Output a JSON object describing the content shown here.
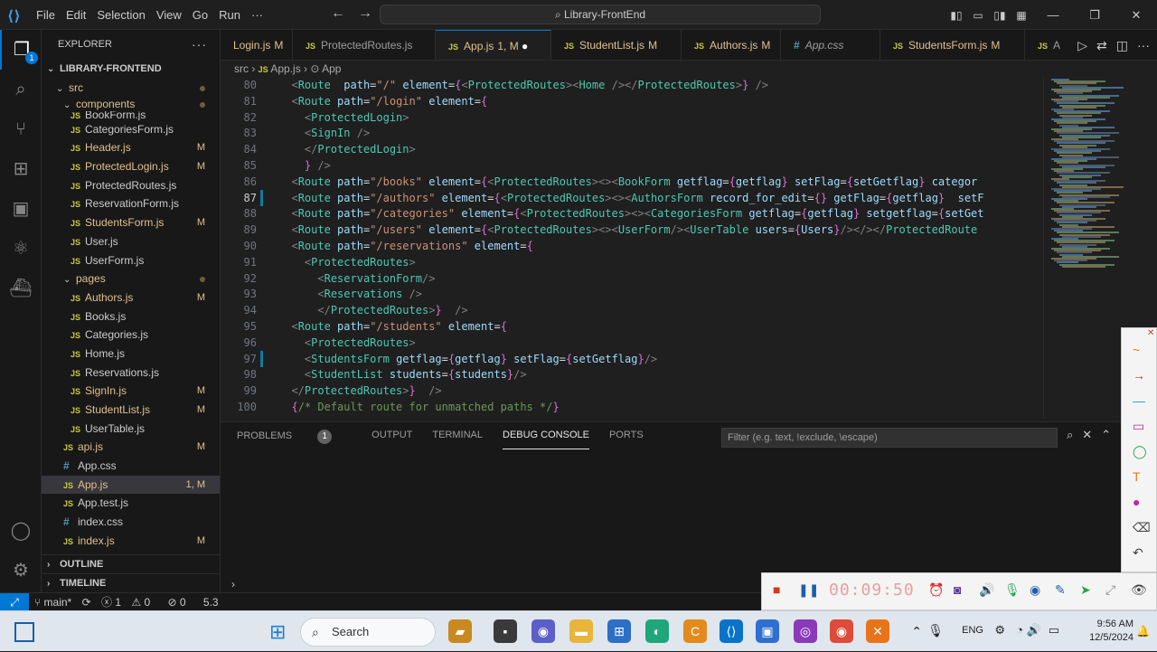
{
  "menu": [
    "File",
    "Edit",
    "Selection",
    "View",
    "Go",
    "Run",
    "···"
  ],
  "search": "Library-FrontEnd",
  "explorer": {
    "title": "EXPLORER",
    "project": "LIBRARY-FRONTEND",
    "src": "src",
    "components": "components",
    "pages": "pages",
    "files_components": [
      {
        "name": "BookForm.js",
        "status": ""
      },
      {
        "name": "CategoriesForm.js",
        "status": ""
      },
      {
        "name": "Header.js",
        "status": "M"
      },
      {
        "name": "ProtectedLogin.js",
        "status": "M"
      },
      {
        "name": "ProtectedRoutes.js",
        "status": ""
      },
      {
        "name": "ReservationForm.js",
        "status": ""
      },
      {
        "name": "StudentsForm.js",
        "status": "M"
      },
      {
        "name": "User.js",
        "status": ""
      },
      {
        "name": "UserForm.js",
        "status": ""
      }
    ],
    "files_pages": [
      {
        "name": "Authors.js",
        "status": "M"
      },
      {
        "name": "Books.js",
        "status": ""
      },
      {
        "name": "Categories.js",
        "status": ""
      },
      {
        "name": "Home.js",
        "status": ""
      },
      {
        "name": "Reservations.js",
        "status": ""
      },
      {
        "name": "SignIn.js",
        "status": "M"
      },
      {
        "name": "StudentList.js",
        "status": "M"
      },
      {
        "name": "UserTable.js",
        "status": ""
      }
    ],
    "files_src": [
      {
        "name": "api.js",
        "status": "M",
        "type": "js"
      },
      {
        "name": "App.css",
        "status": "",
        "type": "css"
      },
      {
        "name": "App.js",
        "status": "1, M",
        "type": "js"
      },
      {
        "name": "App.test.js",
        "status": "",
        "type": "js"
      },
      {
        "name": "index.css",
        "status": "",
        "type": "css"
      },
      {
        "name": "index.js",
        "status": "M",
        "type": "js"
      }
    ],
    "outline": "OUTLINE",
    "timeline": "TIMELINE"
  },
  "tabs": [
    {
      "name": "Login.js",
      "status": "M"
    },
    {
      "name": "ProtectedRoutes.js",
      "status": ""
    },
    {
      "name": "App.js",
      "status": "1, M"
    },
    {
      "name": "StudentList.js",
      "status": "M"
    },
    {
      "name": "Authors.js",
      "status": "M"
    },
    {
      "name": "App.css",
      "status": ""
    },
    {
      "name": "StudentsForm.js",
      "status": "M"
    },
    {
      "name": "A",
      "status": ""
    }
  ],
  "breadcrumb": [
    "src",
    "App.js",
    "App"
  ],
  "code_lines": [
    {
      "n": "80",
      "text": "  <Route  path=\"/\" element={<ProtectedRoutes><Home /></ProtectedRoutes>} />"
    },
    {
      "n": "81",
      "text": "  <Route path=\"/login\" element={"
    },
    {
      "n": "82",
      "text": "    <ProtectedLogin>"
    },
    {
      "n": "83",
      "text": "    <SignIn />"
    },
    {
      "n": "84",
      "text": "    </ProtectedLogin>"
    },
    {
      "n": "85",
      "text": "    } />"
    },
    {
      "n": "86",
      "text": "  <Route path=\"/books\" element={<ProtectedRoutes><><BookForm getflag={getflag} setFlag={setGetflag} categor"
    },
    {
      "n": "87",
      "text": "  <Route path=\"/authors\" element={<ProtectedRoutes><><AuthorsForm record_for_edit={} getFlag={getflag}  setF"
    },
    {
      "n": "88",
      "text": "  <Route path=\"/categories\" element={<ProtectedRoutes><><CategoriesForm getflag={getflag} setgetflag={setGet"
    },
    {
      "n": "89",
      "text": "  <Route path=\"/users\" element={<ProtectedRoutes><><UserForm/><UserTable users={Users}/></></ProtectedRoute"
    },
    {
      "n": "90",
      "text": "  <Route path=\"/reservations\" element={"
    },
    {
      "n": "91",
      "text": "    <ProtectedRoutes>"
    },
    {
      "n": "92",
      "text": "      <ReservationForm/>"
    },
    {
      "n": "93",
      "text": "      <Reservations />"
    },
    {
      "n": "94",
      "text": "      </ProtectedRoutes>}  />"
    },
    {
      "n": "95",
      "text": "  <Route path=\"/students\" element={"
    },
    {
      "n": "96",
      "text": "    <ProtectedRoutes>"
    },
    {
      "n": "97",
      "text": "    <StudentsForm getflag={getflag} setFlag={setGetflag}/>"
    },
    {
      "n": "98",
      "text": "    <StudentList students={students}/>"
    },
    {
      "n": "99",
      "text": "  </ProtectedRoutes>}  />"
    },
    {
      "n": "100",
      "text": "  {/* Default route for unmatched paths */}"
    }
  ],
  "panel": {
    "tabs": [
      "PROBLEMS",
      "OUTPUT",
      "TERMINAL",
      "DEBUG CONSOLE",
      "PORTS"
    ],
    "problems_count": "1",
    "filter_placeholder": "Filter (e.g. text, !exclude, \\escape)"
  },
  "status": {
    "branch": "main*",
    "errors": "1",
    "warnings": "0",
    "info": "0",
    "version": "5.3"
  },
  "recorder": {
    "timer": "00:09:50"
  },
  "taskbar": {
    "search": "Search",
    "lang": "ENG",
    "time": "9:56 AM",
    "date": "12/5/2024"
  },
  "colors": {
    "accent": "#0078d4",
    "modified": "#e2c08d",
    "js_icon": "#cbcb41"
  }
}
